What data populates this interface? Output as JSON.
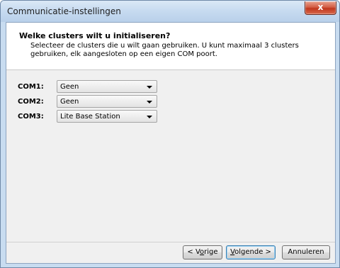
{
  "window": {
    "title": "Communicatie-instellingen",
    "close_label": "x"
  },
  "header": {
    "heading": "Welke clusters wilt u initialiseren?",
    "subtitle": "Selecteer de clusters die u wilt gaan gebruiken. U kunt maximaal 3 clusters gebruiken, elk aangesloten op een eigen COM poort."
  },
  "ports": [
    {
      "label": "COM1:",
      "value": "Geen"
    },
    {
      "label": "COM2:",
      "value": "Geen"
    },
    {
      "label": "COM3:",
      "value": "Lite Base Station"
    }
  ],
  "buttons": {
    "back": {
      "prefix": "< V",
      "mnemonic": "o",
      "suffix": "rige"
    },
    "next": {
      "prefix": "",
      "mnemonic": "V",
      "suffix": "olgende >"
    },
    "cancel": "Annuleren"
  }
}
